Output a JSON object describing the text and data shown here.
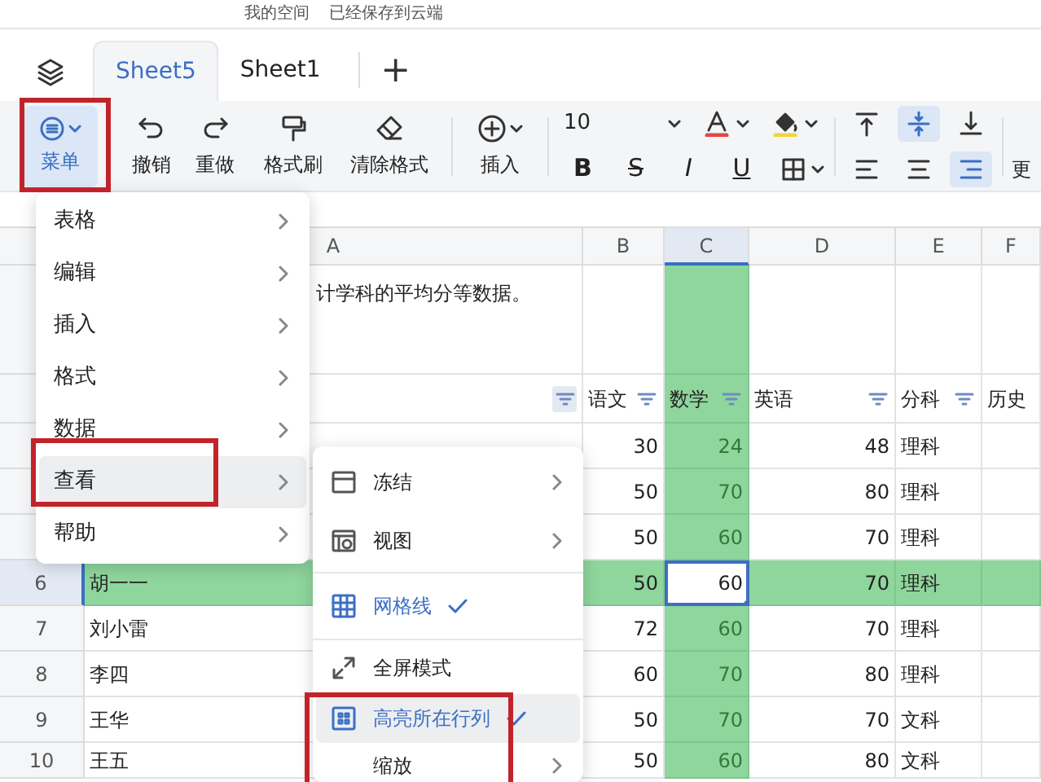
{
  "top_bar": {
    "space": "我的空间",
    "save_status": "已经保存到云端"
  },
  "sheet_tabs": [
    {
      "label": "Sheet5",
      "selected": true
    },
    {
      "label": "Sheet1",
      "selected": false
    }
  ],
  "add_tab": "+",
  "toolbar": {
    "menu_button": {
      "label": "菜单",
      "selected": true
    },
    "actions": [
      {
        "label": "撤销"
      },
      {
        "label": "重做"
      },
      {
        "label": "格式刷"
      },
      {
        "label": "清除格式"
      }
    ],
    "insert": {
      "label": "插入"
    },
    "font_size": "10",
    "format_buttons": [
      "B",
      "S",
      "I",
      "U"
    ],
    "align_buttons": [
      {
        "selected": false
      },
      {
        "selected": true
      },
      {
        "selected": false
      },
      {
        "selected": false
      },
      {
        "selected": false
      },
      {
        "selected": true
      }
    ],
    "more": "更"
  },
  "sheet": {
    "columns": [
      {
        "label": "A",
        "selected": false
      },
      {
        "label": "B",
        "selected": false
      },
      {
        "label": "C",
        "selected": true
      },
      {
        "label": "D",
        "selected": false
      },
      {
        "label": "E",
        "selected": false
      },
      {
        "label": "F",
        "selected": false
      }
    ],
    "rows": [
      {
        "selected": false,
        "cells": {
          "A": {
            "text": "计学科的平均分等数据。"
          }
        }
      },
      {
        "selected": false,
        "cells": {
          "A": {
            "filter": true
          },
          "B": {
            "text": "语文",
            "filter": true
          },
          "C": {
            "text": "数学",
            "filter": true
          },
          "D": {
            "text": "英语",
            "filter": true
          },
          "E": {
            "text": "分科",
            "filter": true
          },
          "F": {
            "text": "历史"
          }
        }
      },
      {
        "selected": false,
        "cells": {
          "B": {
            "text": "30"
          },
          "C": {
            "text": "24"
          },
          "D": {
            "text": "48"
          },
          "E": {
            "text": "理科"
          }
        }
      },
      {
        "selected": false,
        "cells": {
          "B": {
            "text": "50"
          },
          "C": {
            "text": "70"
          },
          "D": {
            "text": "80"
          },
          "E": {
            "text": "理科"
          }
        }
      },
      {
        "selected": false,
        "cells": {
          "B": {
            "text": "50"
          },
          "C": {
            "text": "60"
          },
          "D": {
            "text": "70"
          },
          "E": {
            "text": "理科"
          }
        }
      },
      {
        "number": "6",
        "selected": true,
        "cells": {
          "A": {
            "text": "胡一一"
          },
          "B": {
            "text": "50"
          },
          "C": {
            "text": "60",
            "active": true
          },
          "D": {
            "text": "70"
          },
          "E": {
            "text": "理科"
          }
        }
      },
      {
        "number": "7",
        "selected": false,
        "cells": {
          "A": {
            "text": "刘小雷"
          },
          "B": {
            "text": "72"
          },
          "C": {
            "text": "60"
          },
          "D": {
            "text": "70"
          },
          "E": {
            "text": "理科"
          }
        }
      },
      {
        "number": "8",
        "selected": false,
        "cells": {
          "A": {
            "text": "李四"
          },
          "B": {
            "text": "60"
          },
          "C": {
            "text": "70"
          },
          "D": {
            "text": "80"
          },
          "E": {
            "text": "理科"
          }
        }
      },
      {
        "number": "9",
        "selected": false,
        "cells": {
          "A": {
            "text": "王华"
          },
          "B": {
            "text": "50"
          },
          "C": {
            "text": "70"
          },
          "D": {
            "text": "70"
          },
          "E": {
            "text": "文科"
          }
        }
      },
      {
        "number": "10",
        "selected": false,
        "cells": {
          "A": {
            "text": "王五"
          },
          "B": {
            "text": "50"
          },
          "C": {
            "text": "60"
          },
          "D": {
            "text": "80"
          },
          "E": {
            "text": "文科"
          }
        }
      }
    ]
  },
  "main_menu": [
    {
      "label": "表格",
      "selected": false
    },
    {
      "label": "编辑",
      "selected": false
    },
    {
      "label": "插入",
      "selected": false
    },
    {
      "label": "格式",
      "selected": false
    },
    {
      "label": "数据",
      "selected": false
    },
    {
      "label": "查看",
      "selected": true
    },
    {
      "label": "帮助",
      "selected": false
    }
  ],
  "view_submenu": [
    {
      "label": "冻结",
      "kind": "submenu",
      "selected": false
    },
    {
      "label": "视图",
      "kind": "submenu",
      "selected": false
    },
    {
      "label": "网格线",
      "kind": "toggle",
      "checked": true,
      "selected": false
    },
    {
      "label": "全屏模式",
      "kind": "action",
      "selected": false
    },
    {
      "label": "高亮所在行列",
      "kind": "toggle",
      "checked": true,
      "selected": true
    },
    {
      "label": "缩放",
      "kind": "submenu",
      "selected": false
    }
  ]
}
